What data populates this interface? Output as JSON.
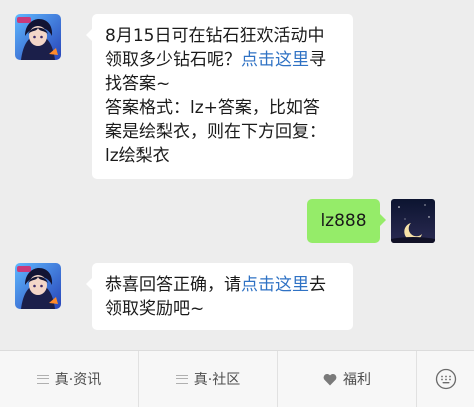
{
  "messages": [
    {
      "sender": "official-account",
      "lines": [
        [
          {
            "text": "8月15日可在钻石狂欢活动中"
          }
        ],
        [
          {
            "text": "领取多少钻石呢？"
          },
          {
            "text": "点击这里",
            "link": true
          },
          {
            "text": "寻"
          }
        ],
        [
          {
            "text": "找答案~"
          }
        ],
        [
          {
            "text": "答案格式：lz+答案，比如答"
          }
        ],
        [
          {
            "text": "案是绘梨衣，则在下方回复："
          }
        ],
        [
          {
            "text": "lz绘梨衣"
          }
        ]
      ]
    },
    {
      "sender": "me",
      "text": "lz888"
    },
    {
      "sender": "official-account",
      "lines": [
        [
          {
            "text": "恭喜回答正确，请"
          },
          {
            "text": "点击这里",
            "link": true
          },
          {
            "text": "去"
          }
        ],
        [
          {
            "text": "领取奖励吧~"
          }
        ]
      ]
    }
  ],
  "menu": {
    "items": [
      {
        "label": "真·资讯",
        "icon": "hamburger-icon"
      },
      {
        "label": "真·社区",
        "icon": "hamburger-icon"
      },
      {
        "label": "福利",
        "icon": "heart-icon"
      },
      {
        "label": "",
        "icon": "keyboard-toggle-icon"
      }
    ]
  },
  "colors": {
    "background": "#ededed",
    "bubble_incoming": "#ffffff",
    "bubble_outgoing": "#95ec69",
    "link": "#2f72c4"
  }
}
